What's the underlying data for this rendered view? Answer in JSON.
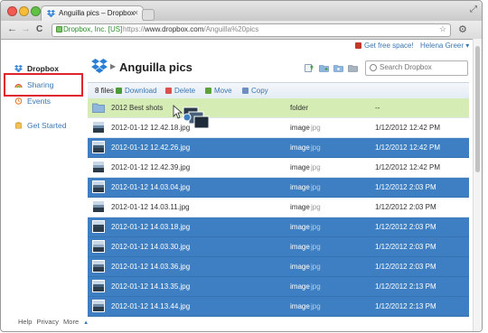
{
  "browser": {
    "tab_title": "Anguilla pics – Dropbox",
    "tab_close": "×",
    "url_ev": "Dropbox, Inc. [US]",
    "url_scheme": "https://",
    "url_host": "www.dropbox.com",
    "url_path": "/Anguilla%20pics",
    "star": "☆",
    "wrench": "⚙",
    "nav_back": "←",
    "nav_forward": "→",
    "nav_reload": "C"
  },
  "header": {
    "get_free_space": "Get free space!",
    "user": "Helena Greer ▾"
  },
  "sidebar": {
    "items": [
      {
        "label": "Dropbox"
      },
      {
        "label": "Sharing"
      },
      {
        "label": "Events"
      },
      {
        "label": "Get Started"
      }
    ],
    "footer": [
      "Help",
      "Privacy",
      "More",
      "▲"
    ]
  },
  "main": {
    "folder_title": "Anguilla pics",
    "breadcrumb_arrow": "▶",
    "search_placeholder": "Search Dropbox",
    "file_count": "8 files",
    "actions": [
      "Download",
      "Delete",
      "Move",
      "Copy"
    ],
    "rows": [
      {
        "name": "2012 Best shots",
        "kind": "folder",
        "ext": "",
        "date": "--",
        "type": "folder"
      },
      {
        "name": "2012-01-12 12.42.18.jpg",
        "kind": "image",
        "ext": "jpg",
        "date": "1/12/2012 12:42 PM",
        "type": "plain"
      },
      {
        "name": "2012-01-12 12.42.26.jpg",
        "kind": "image",
        "ext": "jpg",
        "date": "1/12/2012 12:42 PM",
        "type": "selected"
      },
      {
        "name": "2012-01-12 12.42.39.jpg",
        "kind": "image",
        "ext": "jpg",
        "date": "1/12/2012 12:42 PM",
        "type": "plain"
      },
      {
        "name": "2012-01-12 14.03.04.jpg",
        "kind": "image",
        "ext": "jpg",
        "date": "1/12/2012 2:03 PM",
        "type": "selected"
      },
      {
        "name": "2012-01-12 14.03.11.jpg",
        "kind": "image",
        "ext": "jpg",
        "date": "1/12/2012 2:03 PM",
        "type": "plain"
      },
      {
        "name": "2012-01-12 14.03.18.jpg",
        "kind": "image",
        "ext": "jpg",
        "date": "1/12/2012 2:03 PM",
        "type": "selected"
      },
      {
        "name": "2012-01-12 14.03.30.jpg",
        "kind": "image",
        "ext": "jpg",
        "date": "1/12/2012 2:03 PM",
        "type": "selected"
      },
      {
        "name": "2012-01-12 14.03.36.jpg",
        "kind": "image",
        "ext": "jpg",
        "date": "1/12/2012 2:03 PM",
        "type": "selected"
      },
      {
        "name": "2012-01-12 14.13.35.jpg",
        "kind": "image",
        "ext": "jpg",
        "date": "1/12/2012 2:13 PM",
        "type": "selected"
      },
      {
        "name": "2012-01-12 14.13.44.jpg",
        "kind": "image",
        "ext": "jpg",
        "date": "1/12/2012 2:13 PM",
        "type": "selected"
      }
    ]
  },
  "colors": {
    "selection": "#3d7fc2",
    "folder_row": "#d5ecb4",
    "highlight_box": "#e0242c",
    "link": "#3a76b0"
  },
  "icons": {
    "sidebar": [
      "dropbox-icon",
      "sharing-rainbow-icon",
      "events-icon",
      "get-started-icon"
    ],
    "toolbar": [
      "upload-icon",
      "new-folder-icon",
      "share-folder-icon",
      "show-deleted-icon"
    ]
  }
}
